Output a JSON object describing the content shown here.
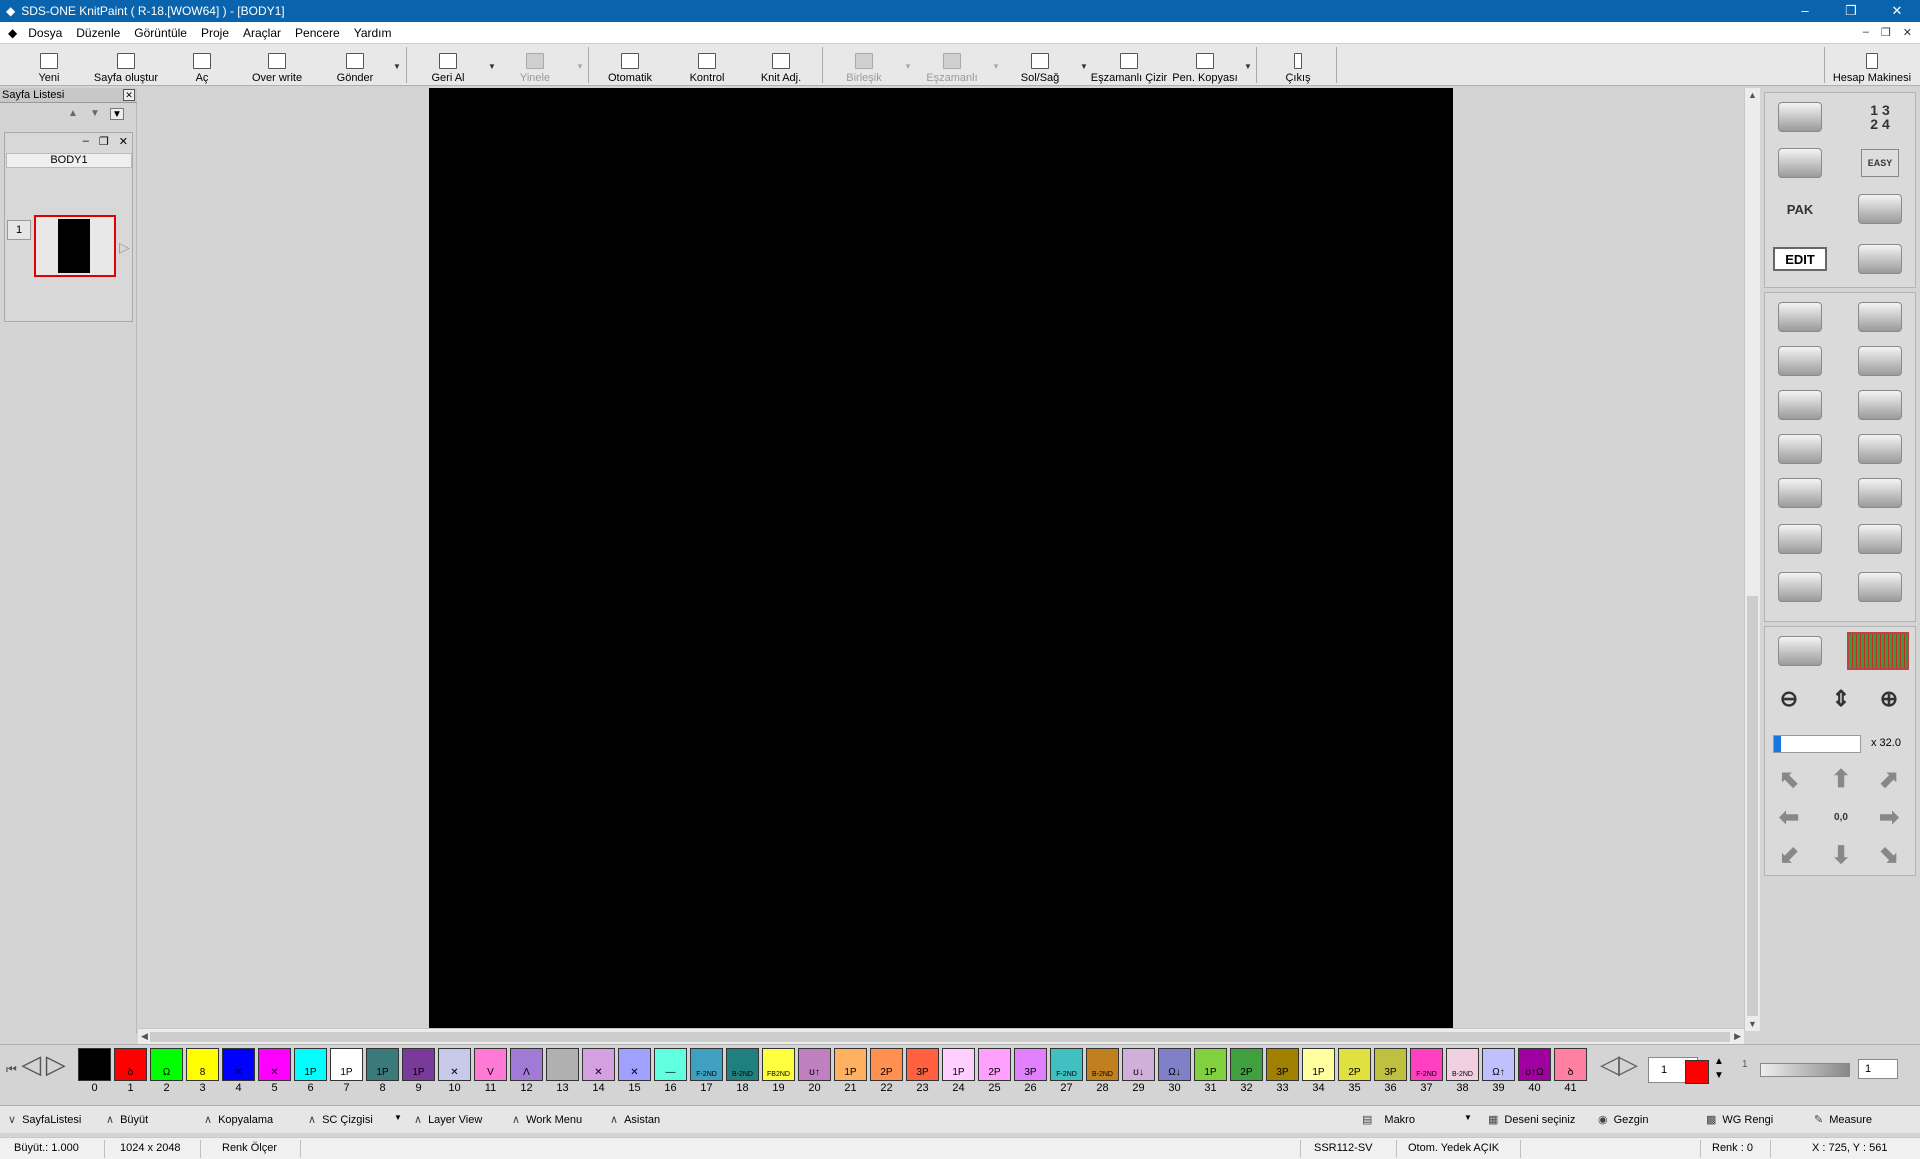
{
  "window": {
    "title": "SDS-ONE KnitPaint ( R-18.[WOW64] ) - [BODY1]",
    "minimize": "–",
    "restore": "❐",
    "close": "✕"
  },
  "menu": [
    "Dosya",
    "Düzenle",
    "Görüntüle",
    "Proje",
    "Araçlar",
    "Pencere",
    "Yardım"
  ],
  "mdi_controls": [
    "–",
    "❐",
    "✕"
  ],
  "toolbar": {
    "buttons": [
      {
        "label": "Yeni",
        "icon": "new-file-icon",
        "enabled": true
      },
      {
        "label": "Sayfa oluştur",
        "icon": "page-create-icon",
        "enabled": true
      },
      {
        "label": "Aç",
        "icon": "open-icon",
        "enabled": true
      },
      {
        "label": "Over write",
        "icon": "save-icon",
        "enabled": true
      },
      {
        "label": "Gönder",
        "icon": "send-icon",
        "enabled": true
      },
      {
        "label": "Geri Al",
        "icon": "undo-icon",
        "enabled": true
      },
      {
        "label": "Yinele",
        "icon": "redo-icon",
        "enabled": false
      },
      {
        "label": "Otomatik",
        "icon": "auto-icon",
        "enabled": true
      },
      {
        "label": "Kontrol",
        "icon": "check-icon",
        "enabled": true
      },
      {
        "label": "Knit Adj.",
        "icon": "knit-adjust-icon",
        "enabled": true
      },
      {
        "label": "Birleşik",
        "icon": "combine-icon",
        "enabled": false
      },
      {
        "label": "Eşzamanlı",
        "icon": "sync-icon",
        "enabled": false
      },
      {
        "label": "Sol/Sağ",
        "icon": "left-right-icon",
        "enabled": true
      },
      {
        "label": "Eşzamanlı Çizir",
        "icon": "sync-draw-icon",
        "enabled": true
      },
      {
        "label": "Pen. Kopyası",
        "icon": "window-copy-icon",
        "enabled": true
      },
      {
        "label": "Çıkış",
        "icon": "exit-icon",
        "enabled": true
      },
      {
        "label": "Hesap Makinesi",
        "icon": "calculator-icon",
        "enabled": true
      }
    ]
  },
  "page_list": {
    "title": "Sayfa Listesi",
    "close": "✕",
    "up": "▲",
    "down": "▼",
    "menu": "▼",
    "sub_controls": [
      "–",
      "❐",
      "✕"
    ],
    "page_name": "BODY1",
    "page_number": "1",
    "thumb_arrow": "▷"
  },
  "scroll": {
    "up": "▲",
    "down": "▼",
    "left": "◀",
    "right": "▶"
  },
  "right_tools": {
    "numbers_glyph": "1 3\n2 4",
    "pak_label": "PAK",
    "edit_label": "EDIT",
    "easy_label": "EASY",
    "zoom_level": "x 32.0",
    "zoom_fill": 0.08,
    "offset_label": "0,0",
    "icons": [
      "pen-icon",
      "numbers-icon",
      "file-icon",
      "easy-icon",
      "pak-icon",
      "transfer-icon",
      "edit-icon",
      "knit-x-icon",
      "draw-line-icon",
      "lasso-icon",
      "circle-cut-icon",
      "rect-resize-icon",
      "light-icon",
      "stairs-icon",
      "cube-icon",
      "bucket-icon",
      "dots-icon",
      "grid-icon",
      "corner-arrow-icon",
      "corner-arrow2-icon",
      "frame-icon",
      "eraser-icon",
      "hand-icon",
      "grid-view-icon",
      "zoom-out-icon",
      "pan-updown-icon",
      "zoom-in-icon"
    ]
  },
  "palette": {
    "swatches": [
      {
        "n": "0",
        "color": "#000000",
        "t": ""
      },
      {
        "n": "1",
        "color": "#ff0000",
        "t": "ꝺ"
      },
      {
        "n": "2",
        "color": "#00ff00",
        "t": "Ω"
      },
      {
        "n": "3",
        "color": "#ffff00",
        "t": "8"
      },
      {
        "n": "4",
        "color": "#0000ff",
        "t": "✕"
      },
      {
        "n": "5",
        "color": "#ff00ff",
        "t": "✕"
      },
      {
        "n": "6",
        "color": "#00ffff",
        "t": "1P"
      },
      {
        "n": "7",
        "color": "#ffffff",
        "t": "1P"
      },
      {
        "n": "8",
        "color": "#3a7a7a",
        "t": "1P"
      },
      {
        "n": "9",
        "color": "#7a3a9a",
        "t": "1P"
      },
      {
        "n": "10",
        "color": "#c8c8e8",
        "t": "✕"
      },
      {
        "n": "11",
        "color": "#ff7ad4",
        "t": "V"
      },
      {
        "n": "12",
        "color": "#a07ad4",
        "t": "Λ"
      },
      {
        "n": "13",
        "color": "#b0b0b0",
        "t": ""
      },
      {
        "n": "14",
        "color": "#d4a0e0",
        "t": "✕"
      },
      {
        "n": "15",
        "color": "#a0a0ff",
        "t": "✕"
      },
      {
        "n": "16",
        "color": "#60ffe0",
        "t": "—"
      },
      {
        "n": "17",
        "color": "#40a0c0",
        "t": "F-2ND"
      },
      {
        "n": "18",
        "color": "#208080",
        "t": "B-2ND"
      },
      {
        "n": "19",
        "color": "#ffff40",
        "t": "FB2ND"
      },
      {
        "n": "20",
        "color": "#c080c0",
        "t": "ʊ↑"
      },
      {
        "n": "21",
        "color": "#ffb060",
        "t": "1P"
      },
      {
        "n": "22",
        "color": "#ff9050",
        "t": "2P"
      },
      {
        "n": "23",
        "color": "#ff6040",
        "t": "3P"
      },
      {
        "n": "24",
        "color": "#ffd0ff",
        "t": "1P"
      },
      {
        "n": "25",
        "color": "#ffa0ff",
        "t": "2P"
      },
      {
        "n": "26",
        "color": "#e080ff",
        "t": "3P"
      },
      {
        "n": "27",
        "color": "#40c0c0",
        "t": "F-2ND"
      },
      {
        "n": "28",
        "color": "#c08020",
        "t": "B-2ND"
      },
      {
        "n": "29",
        "color": "#d0b0d8",
        "t": "ʊ↓"
      },
      {
        "n": "30",
        "color": "#8080c8",
        "t": "Ω↓"
      },
      {
        "n": "31",
        "color": "#80d040",
        "t": "1P"
      },
      {
        "n": "32",
        "color": "#40a040",
        "t": "2P"
      },
      {
        "n": "33",
        "color": "#a08000",
        "t": "3P"
      },
      {
        "n": "34",
        "color": "#ffffa0",
        "t": "1P"
      },
      {
        "n": "35",
        "color": "#e0e040",
        "t": "2P"
      },
      {
        "n": "36",
        "color": "#c0c040",
        "t": "3P"
      },
      {
        "n": "37",
        "color": "#ff40c0",
        "t": "F-2ND"
      },
      {
        "n": "38",
        "color": "#f0d0e0",
        "t": "B-2ND"
      },
      {
        "n": "39",
        "color": "#c0c0ff",
        "t": "Ω↑"
      },
      {
        "n": "40",
        "color": "#a000a0",
        "t": "ʊ↑Ω"
      },
      {
        "n": "41",
        "color": "#ff80a0",
        "t": "ꝺ"
      }
    ],
    "nav_first": "⏮",
    "nav_left": "◁",
    "nav_right": "▷",
    "current_index": "1",
    "current_color": "#ff0000",
    "slider_start": "1",
    "spin_value": "1"
  },
  "funcbar": {
    "items": [
      {
        "label": "SayfaListesi",
        "icon": "chevron-down-icon"
      },
      {
        "label": "Büyüt",
        "icon": "chevron-up-icon"
      },
      {
        "label": "Kopyalama",
        "icon": "chevron-up-icon"
      },
      {
        "label": "SC Çizgisi",
        "icon": "chevron-up-icon"
      },
      {
        "label": "Layer View",
        "icon": "chevron-up-icon"
      },
      {
        "label": "Work Menu",
        "icon": "chevron-up-icon"
      },
      {
        "label": "Asistan",
        "icon": "chevron-up-icon"
      },
      {
        "label": "Makro",
        "icon": "macro-icon"
      },
      {
        "label": "Deseni seçiniz",
        "icon": "pattern-icon"
      },
      {
        "label": "Gezgin",
        "icon": "navigator-icon"
      },
      {
        "label": "WG Rengi",
        "icon": "wg-color-icon"
      },
      {
        "label": "Measure",
        "icon": "measure-icon"
      }
    ]
  },
  "status": {
    "zoom": "Büyüt.: 1.000",
    "size": "1024 x 2048",
    "color_meter": "Renk Ölçer",
    "machine": "SSR112-SV",
    "autosave": "Otom. Yedek AÇIK",
    "color_index": "Renk :  0",
    "coords": "X : 725, Y : 561"
  }
}
